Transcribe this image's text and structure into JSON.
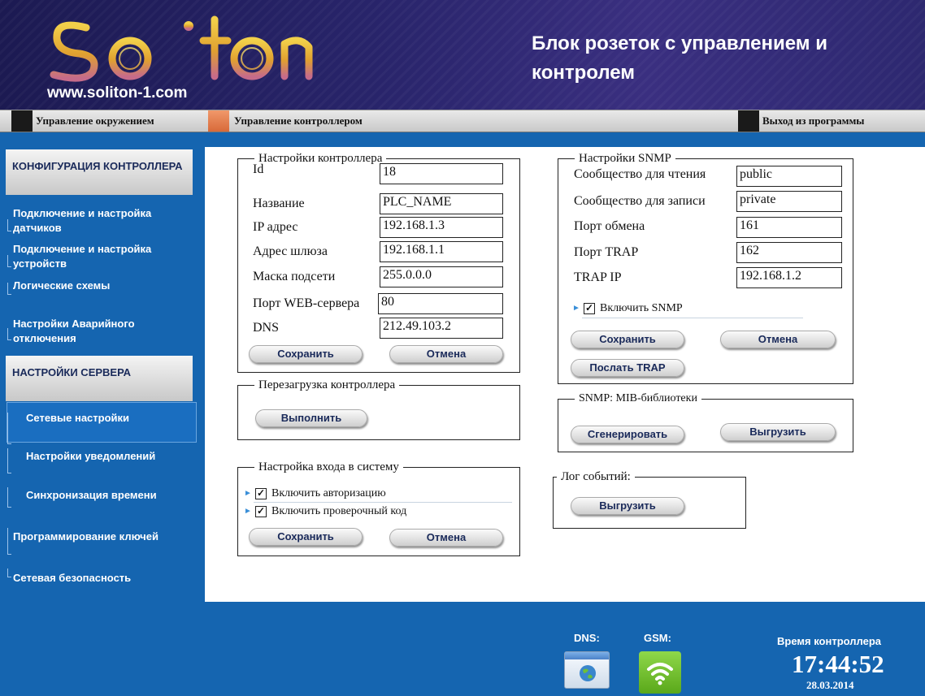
{
  "header": {
    "logo_text": "Soliton",
    "url": "www.soliton-1.com",
    "title": "Блок розеток с управлением и контролем"
  },
  "menu": {
    "env": "Управление окружением",
    "controller": "Управление контроллером",
    "exit": "Выход из программы"
  },
  "sidebar": {
    "config_head": "КОНФИГУРАЦИЯ КОНТРОЛЛЕРА",
    "config_items": [
      "Подключение и настройка датчиков",
      "Подключение и настройка устройств",
      "Логические схемы",
      "Настройки Аварийного отключения"
    ],
    "server_head": "НАСТРОЙКИ СЕРВЕРА",
    "server_items": [
      "Сетевые настройки",
      "Настройки уведомлений",
      "Синхронизация времени",
      "Программирование ключей",
      "Сетевая безопасность"
    ]
  },
  "controller_settings": {
    "legend": "Настройки контроллера",
    "fields": [
      {
        "label": "Id",
        "value": "18"
      },
      {
        "label": "Название",
        "value": "PLC_NAME"
      },
      {
        "label": "IP адрес",
        "value": "192.168.1.3"
      },
      {
        "label": "Адрес шлюза",
        "value": "192.168.1.1"
      },
      {
        "label": "Маска подсети",
        "value": "255.0.0.0"
      },
      {
        "label": "Порт WEB-сервера",
        "value": "80"
      },
      {
        "label": "DNS",
        "value": "212.49.103.2"
      }
    ],
    "save": "Сохранить",
    "cancel": "Отмена"
  },
  "reboot": {
    "legend": "Перезагрузка контроллера",
    "execute": "Выполнить"
  },
  "login": {
    "legend": "Настройка входа в систему",
    "auth": "Включить авторизацию",
    "captcha": "Включить проверочный код",
    "auth_checked": true,
    "captcha_checked": true,
    "check_mark": "✓",
    "save": "Сохранить",
    "cancel": "Отмена"
  },
  "snmp": {
    "legend": "Настройки SNMP",
    "fields": [
      {
        "label": "Сообщество для чтения",
        "value": "public"
      },
      {
        "label": "Сообщество для записи",
        "value": "private"
      },
      {
        "label": "Порт обмена",
        "value": "161"
      },
      {
        "label": "Порт TRAP",
        "value": "162"
      },
      {
        "label": "TRAP IP",
        "value": "192.168.1.2"
      }
    ],
    "enable": "Включить SNMP",
    "enable_checked": true,
    "save": "Сохранить",
    "cancel": "Отмена",
    "send_trap": "Послать TRAP"
  },
  "mib": {
    "legend": "SNMP: MIB-библиотеки",
    "generate": "Сгенерировать",
    "export": "Выгрузить"
  },
  "log": {
    "legend": "Лог событий:",
    "export": "Выгрузить"
  },
  "status": {
    "dns_label": "DNS:",
    "gsm_label": "GSM:",
    "time_label": "Время контроллера",
    "time": "17:44:52",
    "date": "28.03.2014"
  },
  "colors": {
    "background": "#1565b0",
    "menu_square_dark": "#1a1a1a",
    "menu_square_active": "#e87a4a",
    "gsm_green": "#6ec02a"
  }
}
